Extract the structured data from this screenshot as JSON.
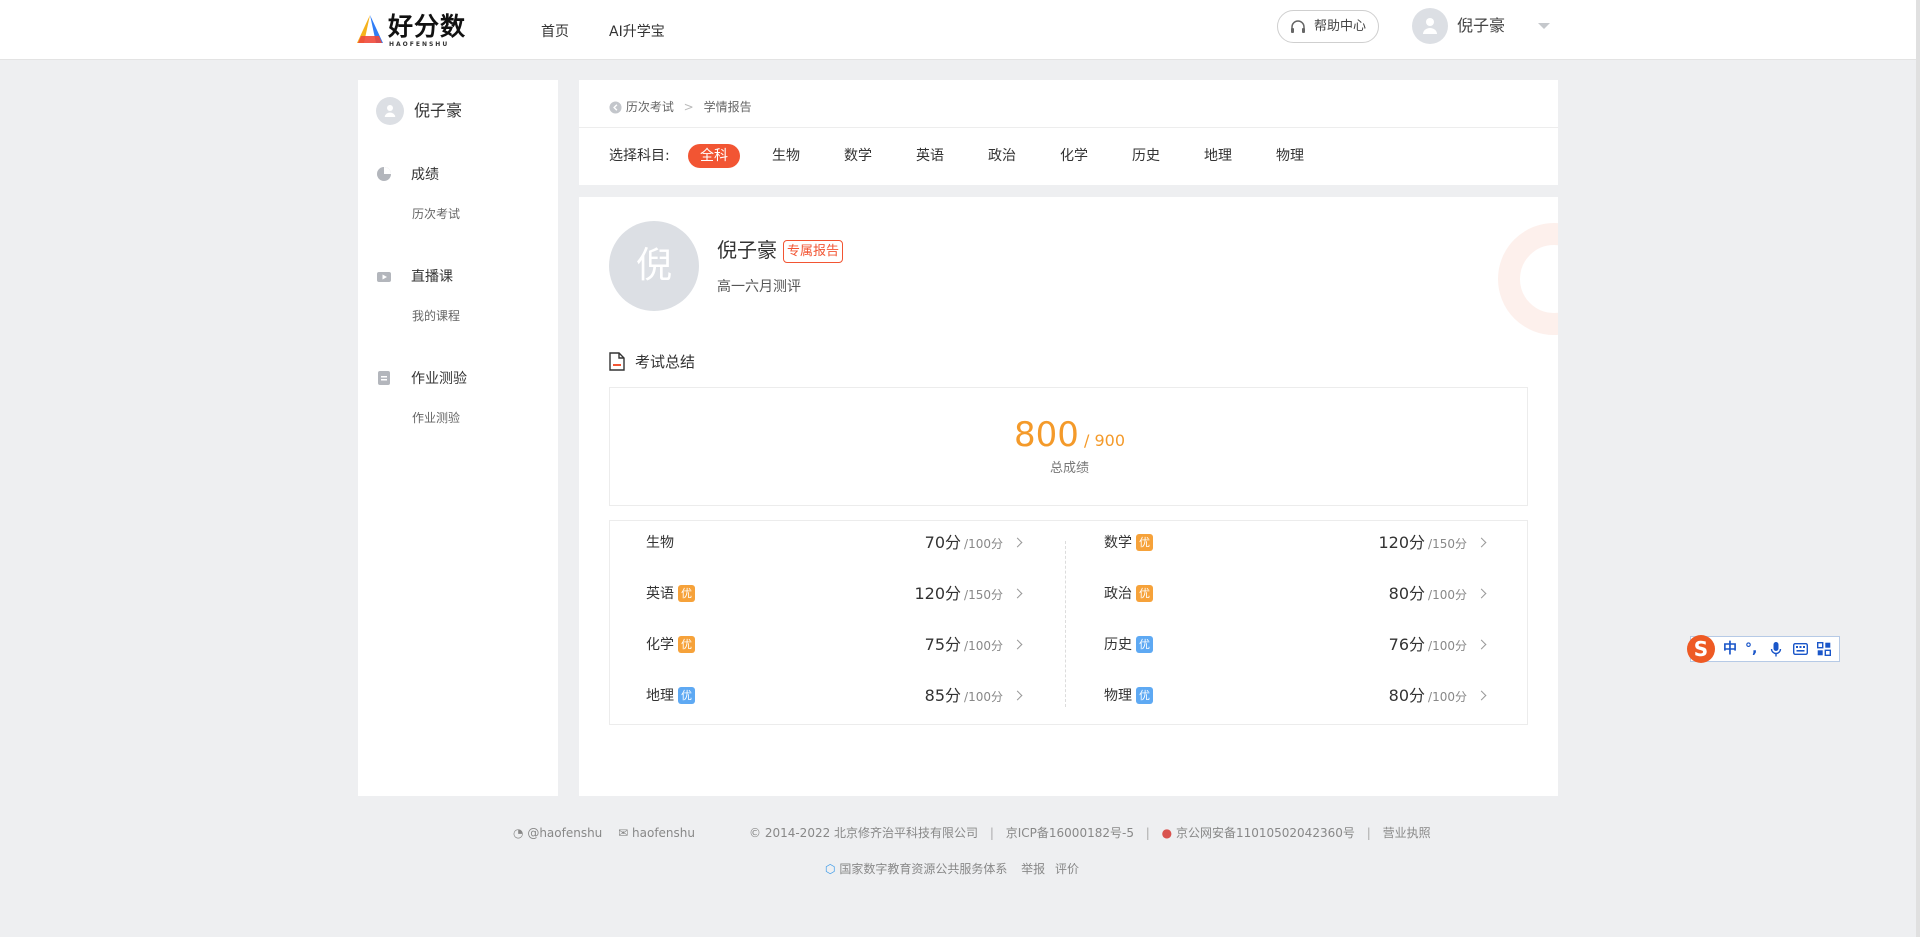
{
  "header": {
    "logo_name": "好分数",
    "logo_sub": "HAOFENSHU",
    "nav": [
      "首页",
      "AI升学宝"
    ],
    "help_label": "帮助中心",
    "user_name": "倪子豪"
  },
  "sidebar": {
    "user_name": "倪子豪",
    "sections": [
      {
        "title": "成绩",
        "icon": "pie-chart-icon",
        "sub": "历次考试"
      },
      {
        "title": "直播课",
        "icon": "video-icon",
        "sub": "我的课程"
      },
      {
        "title": "作业测验",
        "icon": "document-icon",
        "sub": "作业测验"
      }
    ]
  },
  "breadcrumb": {
    "back": "历次考试",
    "current": "学情报告"
  },
  "filter": {
    "label": "选择科目:",
    "subjects": [
      "全科",
      "生物",
      "数学",
      "英语",
      "政治",
      "化学",
      "历史",
      "地理",
      "物理"
    ],
    "active": "全科"
  },
  "report": {
    "avatar_char": "倪",
    "student_name": "倪子豪",
    "badge": "专属报告",
    "exam_name": "高一六月测评",
    "summary_title": "考试总结",
    "total_score": "800",
    "total_full": "/ 900",
    "total_label": "总成绩",
    "subjects": [
      {
        "name": "生物",
        "tag": "",
        "tag_color": "",
        "score": "70分",
        "full": "/100分"
      },
      {
        "name": "数学",
        "tag": "优",
        "tag_color": "#f6a23a",
        "score": "120分",
        "full": "/150分"
      },
      {
        "name": "英语",
        "tag": "优",
        "tag_color": "#f6a23a",
        "score": "120分",
        "full": "/150分"
      },
      {
        "name": "政治",
        "tag": "优",
        "tag_color": "#f6a23a",
        "score": "80分",
        "full": "/100分"
      },
      {
        "name": "化学",
        "tag": "优",
        "tag_color": "#f6a23a",
        "score": "75分",
        "full": "/100分"
      },
      {
        "name": "历史",
        "tag": "优",
        "tag_color": "#5ea9f3",
        "score": "76分",
        "full": "/100分"
      },
      {
        "name": "地理",
        "tag": "优",
        "tag_color": "#5ea9f3",
        "score": "85分",
        "full": "/100分"
      },
      {
        "name": "物理",
        "tag": "优",
        "tag_color": "#5ea9f3",
        "score": "80分",
        "full": "/100分"
      }
    ]
  },
  "ime": {
    "logo": "S",
    "items": [
      "中",
      "°,",
      "mic-icon",
      "keyboard-icon",
      "grid-icon"
    ]
  },
  "footer": {
    "weibo": "@haofenshu",
    "wechat": "haofenshu",
    "copyright": "© 2014-2022 北京修齐治平科技有限公司",
    "icp": "京ICP备16000182号-5",
    "police": "京公网安备11010502042360号",
    "license": "营业执照",
    "platform": "国家数字教育资源公共服务体系",
    "report": "举报",
    "review": "评价"
  },
  "colors": {
    "accent": "#f25533",
    "score": "#f49a2a",
    "tag_orange": "#f6a23a",
    "tag_blue": "#5ea9f3",
    "page_bg": "#eeeff1"
  }
}
